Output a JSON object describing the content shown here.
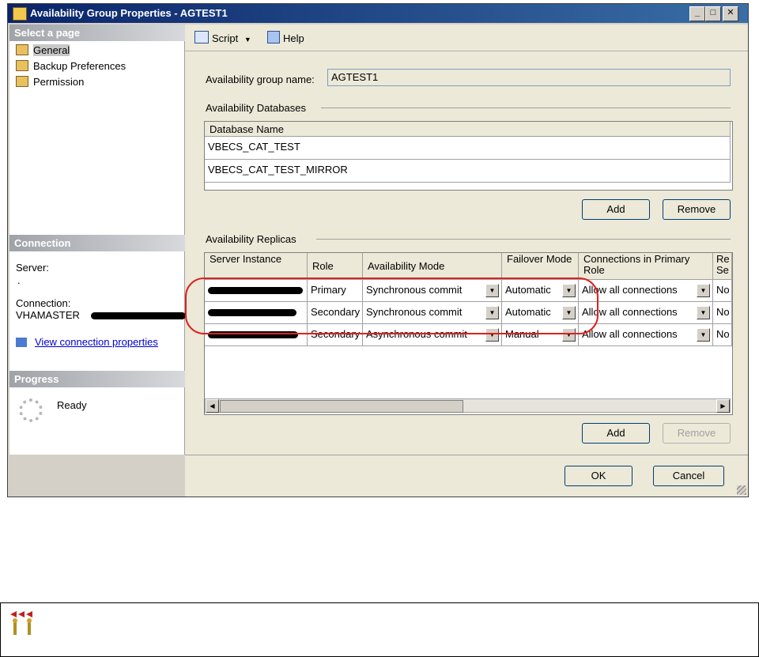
{
  "window": {
    "title": "Availability Group Properties - AGTEST1",
    "minimize": "_",
    "maximize": "□",
    "close": "✕"
  },
  "sidebar": {
    "select_header": "Select a page",
    "items": [
      {
        "label": "General",
        "icon": "page-icon",
        "selected": true
      },
      {
        "label": "Backup Preferences",
        "icon": "page-icon"
      },
      {
        "label": "Permission",
        "icon": "page-icon"
      }
    ],
    "connection_header": "Connection",
    "server_label": "Server:",
    "server_value": ".",
    "connection_label": "Connection:",
    "connection_value": "VHAMASTER",
    "view_link": "View connection properties",
    "progress_header": "Progress",
    "progress_status": "Ready"
  },
  "toolbar": {
    "script_label": "Script",
    "help_label": "Help"
  },
  "general": {
    "ag_name_label": "Availability group name:",
    "ag_name_value": "AGTEST1",
    "databases_title": "Availability Databases",
    "db_column": "Database Name",
    "databases": [
      "VBECS_CAT_TEST",
      "VBECS_CAT_TEST_MIRROR"
    ],
    "add_label": "Add",
    "remove_label": "Remove",
    "replicas_title": "Availability Replicas",
    "replica_columns": {
      "server": "Server Instance",
      "role": "Role",
      "mode": "Availability Mode",
      "failover": "Failover Mode",
      "conn_primary": "Connections in Primary Role",
      "readable": "Re Se"
    },
    "replicas": [
      {
        "role": "Primary",
        "mode": "Synchronous commit",
        "failover": "Automatic",
        "conn": "Allow all connections",
        "readable": "No"
      },
      {
        "role": "Secondary",
        "mode": "Synchronous commit",
        "failover": "Automatic",
        "conn": "Allow all connections",
        "readable": "No"
      },
      {
        "role": "Secondary",
        "mode": "Asynchronous commit",
        "failover": "Manual",
        "conn": "Allow all connections",
        "readable": "No"
      }
    ],
    "replica_add_label": "Add",
    "replica_remove_label": "Remove"
  },
  "footer": {
    "ok_label": "OK",
    "cancel_label": "Cancel"
  },
  "colors": {
    "highlight_oval": "#e02020",
    "titlebar": "#0a246a"
  }
}
